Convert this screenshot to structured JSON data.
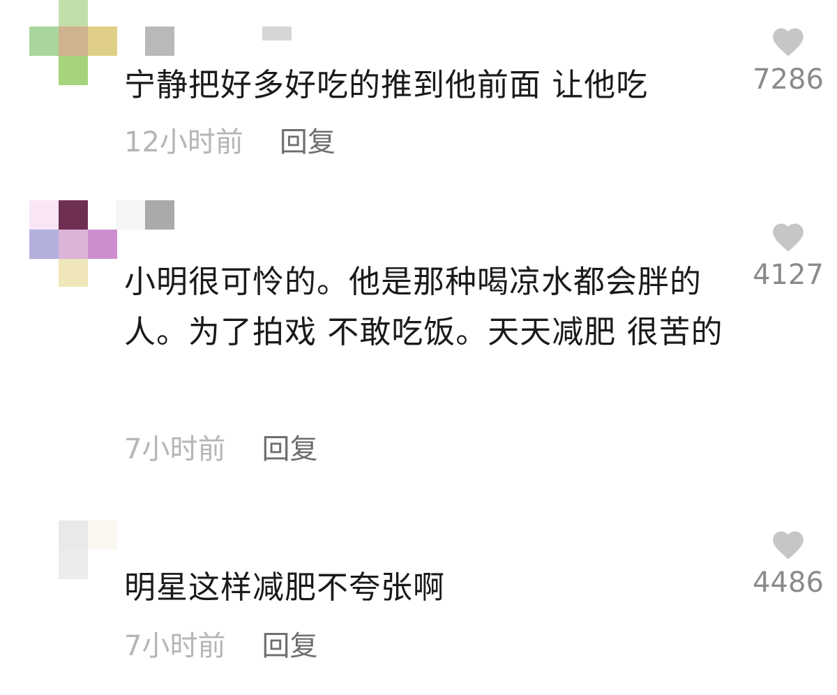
{
  "comments": [
    {
      "text": "宁静把好多好吃的推到他前面 让他吃",
      "time": "12小时前",
      "reply_label": "回复",
      "likes": "7286"
    },
    {
      "text": "小明很可怜的。他是那种喝凉水都会胖的人。为了拍戏 不敢吃饭。天天减肥 很苦的",
      "time": "7小时前",
      "reply_label": "回复",
      "likes": "4127"
    },
    {
      "text": "明星这样减肥不夸张啊",
      "time": "7小时前",
      "reply_label": "回复",
      "likes": "4486"
    }
  ],
  "colors": {
    "heart": "#c6c6c6",
    "text": "#1a1a1a",
    "time": "#b5b5b5",
    "reply": "#6e6e6e",
    "count": "#8a8a8a"
  },
  "icons": {
    "like": "heart-icon",
    "avatar": "pixelated-avatar"
  }
}
